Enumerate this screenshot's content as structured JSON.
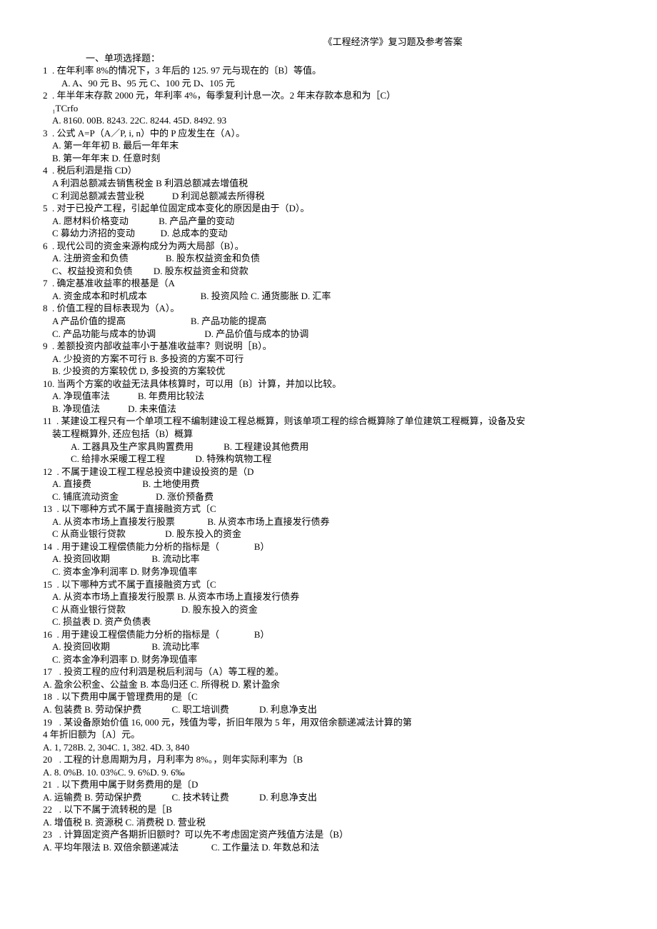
{
  "title": "《工程经济学》复习题及参考答案",
  "section_heading": "一、单项选择题：",
  "lines": [
    "1  . 在年利率 8%的情况下，3 年后的 125. 97 元与现在的〔B〕等值。",
    "        A. A、90 元 B、95 元 C、100 元 D、105 元",
    "2  . 年半年末存款 2000 元，年利率 4%，每季复利计息一次。2 年末存款本息和为［C）",
    "    ₁TCrfo",
    "    A. 8160. 00B. 8243. 22C. 8244. 45D. 8492. 93",
    "3  . 公式 A=P（A／P, i, n）中的 P 应发生在（A）。",
    "    A. 第一年年初 B. 最后一年年末",
    "    B. 第一年年末 D. 任意时刻",
    "4  . 税后利泗是指 CD）",
    "    A 利泗总额减去销售税金 B 利泗总额减去增值税",
    "    C 利润总额减去营业税            D 利润总额减去所得税",
    "5  . 对于已投产工程，引起单位固定成本变化的原因是由于（D）。",
    "    A. 愿材料价格变动             B. 产品产量的变动",
    "    C 募幼力济招的变动           D. 总成本的变动",
    "6  . 现代公司的资金来源构成分为两大局部（B）。",
    "    A. 注册资金和负债                B. 股东权益资金和负债",
    "    C、权益投资和负债         D. 股东权益资金和贷款",
    "7  . 确定基准收益率的根基是（A",
    "    A. 资金成本和时机成本                       B. 投资风险 C. 通货膨胀 D. 汇率",
    "8  . 价值工程的目标表现为（A）。",
    "    A 产品价值的提高                            B. 产品功能的提高",
    "    C. 产品功能与成本的协调                     D. 产品价值与成本的协调",
    "9  . 差额投资内部收益率小于基准收益率？则说明［B）。",
    "    A. 少投资的方案不可行 B. 多投资的方案不可行",
    "    B. 少投资的方案较优 D, 多投资的方案较优",
    "10. 当两个方案的收益无法具体核算时，可以用〔B〕计算，并加以比较。",
    "    A. 净现值率法            B. 年费用比较法",
    "    B. 净现值法            D. 未来值法",
    "11  . 某建设工程只有一个单项工程不编制建设工程总概算，则该单项工程的综合概算除了单位建筑工程概算，设备及安",
    "    装工程概算外, 还应包括（B）概算",
    "            A. 工器具及生产家具购置费用             B. 工程建设其他费用",
    "            C. 给排水采暖工程工程             D. 特殊构筑物工程",
    "12  . 不属于建设工程工程总投资中建设投资的是（D",
    "    A. 直接费                      B. 土地使用费",
    "    C. 铺底流动资金                D. 涨价预备费",
    "13  . 以下哪种方式不属于直接融资方式〔C",
    "    A. 从资本市场上直接发行股票              B. 从资本市场上直接发行债券",
    "    C 从商业银行贷款                 D. 股东投入的资金",
    "14  . 用于建设工程偿债能力分析的指标是（               B）",
    "    A. 投资回收期                  B. 流动比率",
    "    C. 资本金净利润率 D. 财务净现值率",
    "15  . 以下哪种方式不属于直接融资方式〔C",
    "    A. 从资本市场上直接发行股票 B. 从资本市场上直接发行债券",
    "    C 从商业银行贷款                        D. 股东投入的资金",
    "    C. 损益表 D. 资产负债表",
    "16  . 用于建设工程偿债能力分析的指标是（               B）",
    "    A. 投资回收期                  B. 流动比率",
    "    C. 资本金净利泗率 D. 财务净现值率",
    "17   . 投资工程的应付利泗是税后利润与（A）等工程的差。",
    "A. 盈余公积金、公益金 B. 本岛归还 C. 所得税 D. 累计盈余",
    "18  . 以下费用中属于管理费用的是〔C",
    "A. 包装费 B. 劳动保护费             C. 职工培训费             D. 利息净支出",
    "19   . 某设备原始价值 16, 000 元，残值为零，折旧年限为 5 年，用双倍余额递减法计算的第",
    "4 年折旧额为〔A〕元。",
    "A. 1, 728B. 2, 304C. 1, 382. 4D. 3, 840",
    "20   . 工程的计息周期为月，月利率为 8%。，则年实际利率为〔B",
    "A. 8. 0%B. 10. 03%C. 9. 6%D. 9. 6‰",
    "21  . 以下费用中属于财务费用的是〔D",
    "A. 运输费 B. 劳动保护费             C. 技术转让费             D. 利息净支出",
    "22   . 以下不属于流转税的是［B",
    "A. 增值税 B. 资源税 C. 消费税 D. 营业税",
    "23   . 计算固定资产各期折旧额时？可以先不考虑固定资产残值方法是（B）",
    "A. 平均年限法 B. 双倍余额递减法              C. 工作量法 D. 年数总和法"
  ]
}
